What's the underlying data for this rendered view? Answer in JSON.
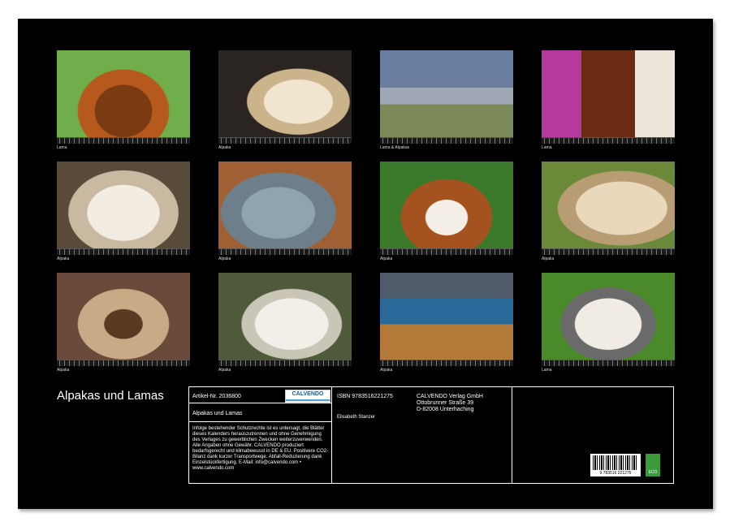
{
  "calendar_title": "Alpakas und Lamas",
  "photos": [
    {
      "caption": "Lama",
      "scene": "lama-close-up-orange"
    },
    {
      "caption": "Alpaka",
      "scene": "alpaka-profile-cream"
    },
    {
      "caption": "Lama & Alpakas",
      "scene": "lama-herd-sky"
    },
    {
      "caption": "Lama",
      "scene": "lama-colorful-textile"
    },
    {
      "caption": "Alpaka",
      "scene": "alpaka-white-fluffy"
    },
    {
      "caption": "Alpaka",
      "scene": "alpaka-gray-wet"
    },
    {
      "caption": "Alpaka",
      "scene": "alpaka-brown-white"
    },
    {
      "caption": "Alpaka",
      "scene": "alpaka-beige-grass"
    },
    {
      "caption": "Alpaka",
      "scene": "alpaka-shaggy-brown"
    },
    {
      "caption": "Alpaka",
      "scene": "alpaka-white-fence"
    },
    {
      "caption": "Alpaka",
      "scene": "alpaka-lake-landscape"
    },
    {
      "caption": "Lama",
      "scene": "lama-white-green-leaves"
    }
  ],
  "info": {
    "article_number": "Artikel-Nr. 2036800",
    "logo_text": "CALVENDO",
    "product_title": "Alpakas und Lamas",
    "legal_text": "Infolge bestehender Schutzrechte ist es untersagt, die Blätter dieses Kalenders herauszutrennen und ohne Genehmigung des Verlages zu gewerblichen Zwecken weiterzuverwenden. Alle Angaben ohne Gewähr. CALVENDO produziert bedarfsgerecht und klimabewusst in DE & EU. Positivere CO2-Bilanz dank kurzer Transportwege. Abfall-Reduzierung dank Einzelstückfertigung. E-Mail: info@calvendo.com • www.calvendo.com",
    "isbn": "ISBN 9783516221275",
    "author": "Elisabeth Stanzer",
    "publisher_line1": "CALVENDO Verlag GmbH",
    "publisher_line2": "Ottobrunner Straße 39",
    "publisher_line3": "D-82008 Unterhaching",
    "barcode_number": "9 783516 221275",
    "eco_label": "ECO"
  },
  "colors": {
    "sheet": "#000000",
    "page": "#ffffff",
    "eco": "#3d9a3a"
  }
}
